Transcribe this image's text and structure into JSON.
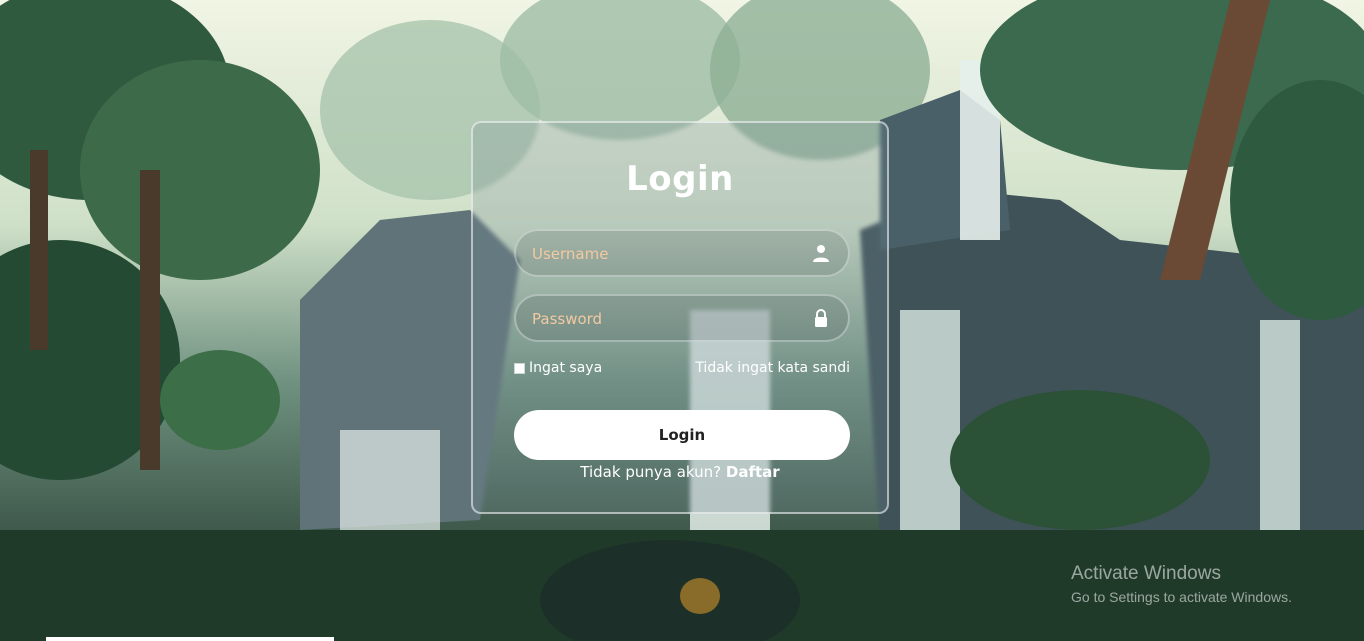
{
  "login_card": {
    "title": "Login",
    "username": {
      "placeholder": "Username",
      "icon": "user-icon"
    },
    "password": {
      "placeholder": "Password",
      "icon": "lock-icon"
    },
    "remember_label": "Ingat saya",
    "forgot_label": "Tidak ingat kata sandi",
    "submit_label": "Login",
    "register_prompt": "Tidak punya akun?",
    "register_link": "Daftar"
  },
  "watermark": {
    "title": "Activate Windows",
    "subtitle": "Go to Settings to activate Windows."
  },
  "colors": {
    "placeholder": "#f3c9a0",
    "button_bg": "#ffffff",
    "text": "#ffffff"
  }
}
